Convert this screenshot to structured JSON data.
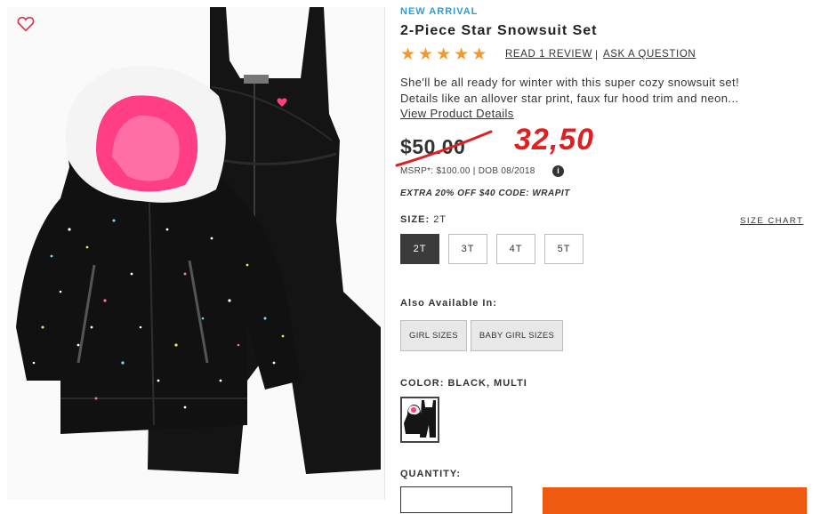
{
  "product": {
    "badge": "NEW ARRIVAL",
    "title": "2-Piece Star Snowsuit Set",
    "rating_stars": 5,
    "review_link": "READ 1 REVIEW",
    "separator": "|",
    "ask_link": "ASK A QUESTION",
    "description": "She'll be all ready for winter with this super cozy snowsuit set! Details like an allover star print, faux fur hood trim and neon...",
    "view_details": "View Product Details"
  },
  "pricing": {
    "price": "$50.00",
    "handwritten_price": "32,50",
    "msrp_text": "MSRP*: $100.00 | DOB 08/2018",
    "info_icon": "i",
    "promo": "EXTRA 20% OFF $40 CODE: WRAPIT"
  },
  "size": {
    "label": "SIZE:",
    "selected": "2T",
    "chart_link": "SIZE CHART",
    "options": [
      "2T",
      "3T",
      "4T",
      "5T"
    ]
  },
  "also_available": {
    "label": "Also Available In:",
    "options": [
      "GIRL SIZES",
      "BABY GIRL SIZES"
    ]
  },
  "color": {
    "label": "COLOR:",
    "selected": "BLACK, MULTI"
  },
  "quantity": {
    "label": "QUANTITY:"
  },
  "colors": {
    "accent_blue": "#2a9dd6",
    "star": "#f2992e",
    "selected_size": "#3b3b3b",
    "add_to_bag": "#ee5a0f",
    "handwritten": "#e02020"
  },
  "icons": {
    "wishlist": "heart-outline-icon",
    "info": "info-icon"
  }
}
